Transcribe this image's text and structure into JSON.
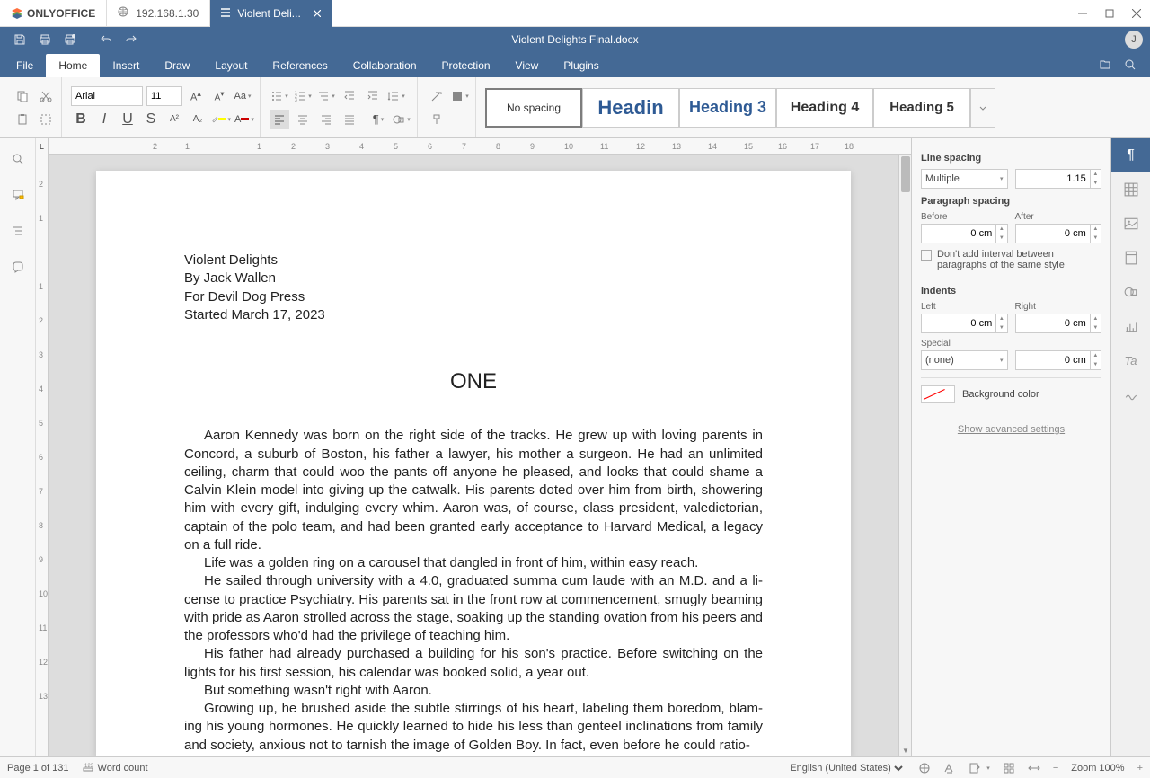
{
  "titlebar": {
    "logo": "ONLYOFFICE",
    "tabs": [
      {
        "label": "192.168.1.30"
      },
      {
        "label": "Violent Deli..."
      }
    ]
  },
  "toolbar": {
    "doc_title": "Violent Delights Final.docx",
    "avatar_initial": "J"
  },
  "menu": {
    "items": [
      "File",
      "Home",
      "Insert",
      "Draw",
      "Layout",
      "References",
      "Collaboration",
      "Protection",
      "View",
      "Plugins"
    ],
    "active": "Home"
  },
  "ribbon": {
    "font_name": "Arial",
    "font_size": "11",
    "styles": [
      "No spacing",
      "Headin",
      "Heading 3",
      "Heading 4",
      "Heading 5"
    ]
  },
  "document": {
    "meta": [
      "Violent Delights",
      "By Jack Wallen",
      "For Devil Dog Press",
      "Started March 17, 2023"
    ],
    "chapter": "ONE",
    "paras": [
      "Aaron Kennedy was born on the right side of the tracks. He grew up with loving parents in Concord, a suburb of Boston, his father a lawyer, his mother a surgeon. He had an unlimited ceiling, charm that could woo the pants off anyone he pleased, and looks that could shame a Calvin Klein model into giving up the catwalk. His parents doted over him from birth, showering him with every gift, indulging every whim. Aaron was, of course, class president, valedictorian, captain of the polo team, and had been granted early acceptance to Harvard Medical, a legacy on a full ride.",
      "Life was a golden ring on a carousel that dangled in front of him, within easy reach.",
      "He sailed through university with a 4.0, graduated summa cum laude with an M.D. and a li­cense to practice Psychiatry. His parents sat in the front row at commencement, smugly beaming with pride as Aaron strolled across the stage, soaking up the standing ovation from his peers and the professors who'd had the privilege of teaching him.",
      "His father had already purchased a building for his son's practice. Before switching on the lights for his first session, his calendar was booked solid, a year out.",
      "But something wasn't right with Aaron.",
      "Growing up, he brushed aside the subtle stirrings of his heart, labeling them boredom, blam­ing his young hormones. He quickly learned to hide his less than genteel inclinations from family and society, anxious not to tarnish the image of Golden Boy. In fact, even before he could ratio-"
    ]
  },
  "right_panel": {
    "line_spacing_label": "Line spacing",
    "line_spacing_mode": "Multiple",
    "line_spacing_value": "1.15",
    "para_spacing_label": "Paragraph spacing",
    "before_label": "Before",
    "after_label": "After",
    "before_value": "0 cm",
    "after_value": "0 cm",
    "dont_add_label": "Don't add interval between paragraphs of the same style",
    "indents_label": "Indents",
    "left_label": "Left",
    "right_label": "Right",
    "left_value": "0 cm",
    "right_value": "0 cm",
    "special_label": "Special",
    "special_value": "(none)",
    "special_by": "0 cm",
    "bgcolor_label": "Background color",
    "advanced_label": "Show advanced settings"
  },
  "statusbar": {
    "page": "Page 1 of 131",
    "wordcount": "Word count",
    "language": "English (United States)",
    "zoom": "Zoom 100%"
  },
  "ruler_h": [
    "2",
    "1",
    "",
    "1",
    "2",
    "3",
    "4",
    "5",
    "6",
    "7",
    "8",
    "9",
    "10",
    "11",
    "12",
    "13",
    "14",
    "15",
    "16",
    "17",
    "18"
  ],
  "ruler_v": [
    "2",
    "1",
    "",
    "1",
    "2",
    "3",
    "4",
    "5",
    "6",
    "7",
    "8",
    "9",
    "10",
    "11",
    "12",
    "13"
  ]
}
